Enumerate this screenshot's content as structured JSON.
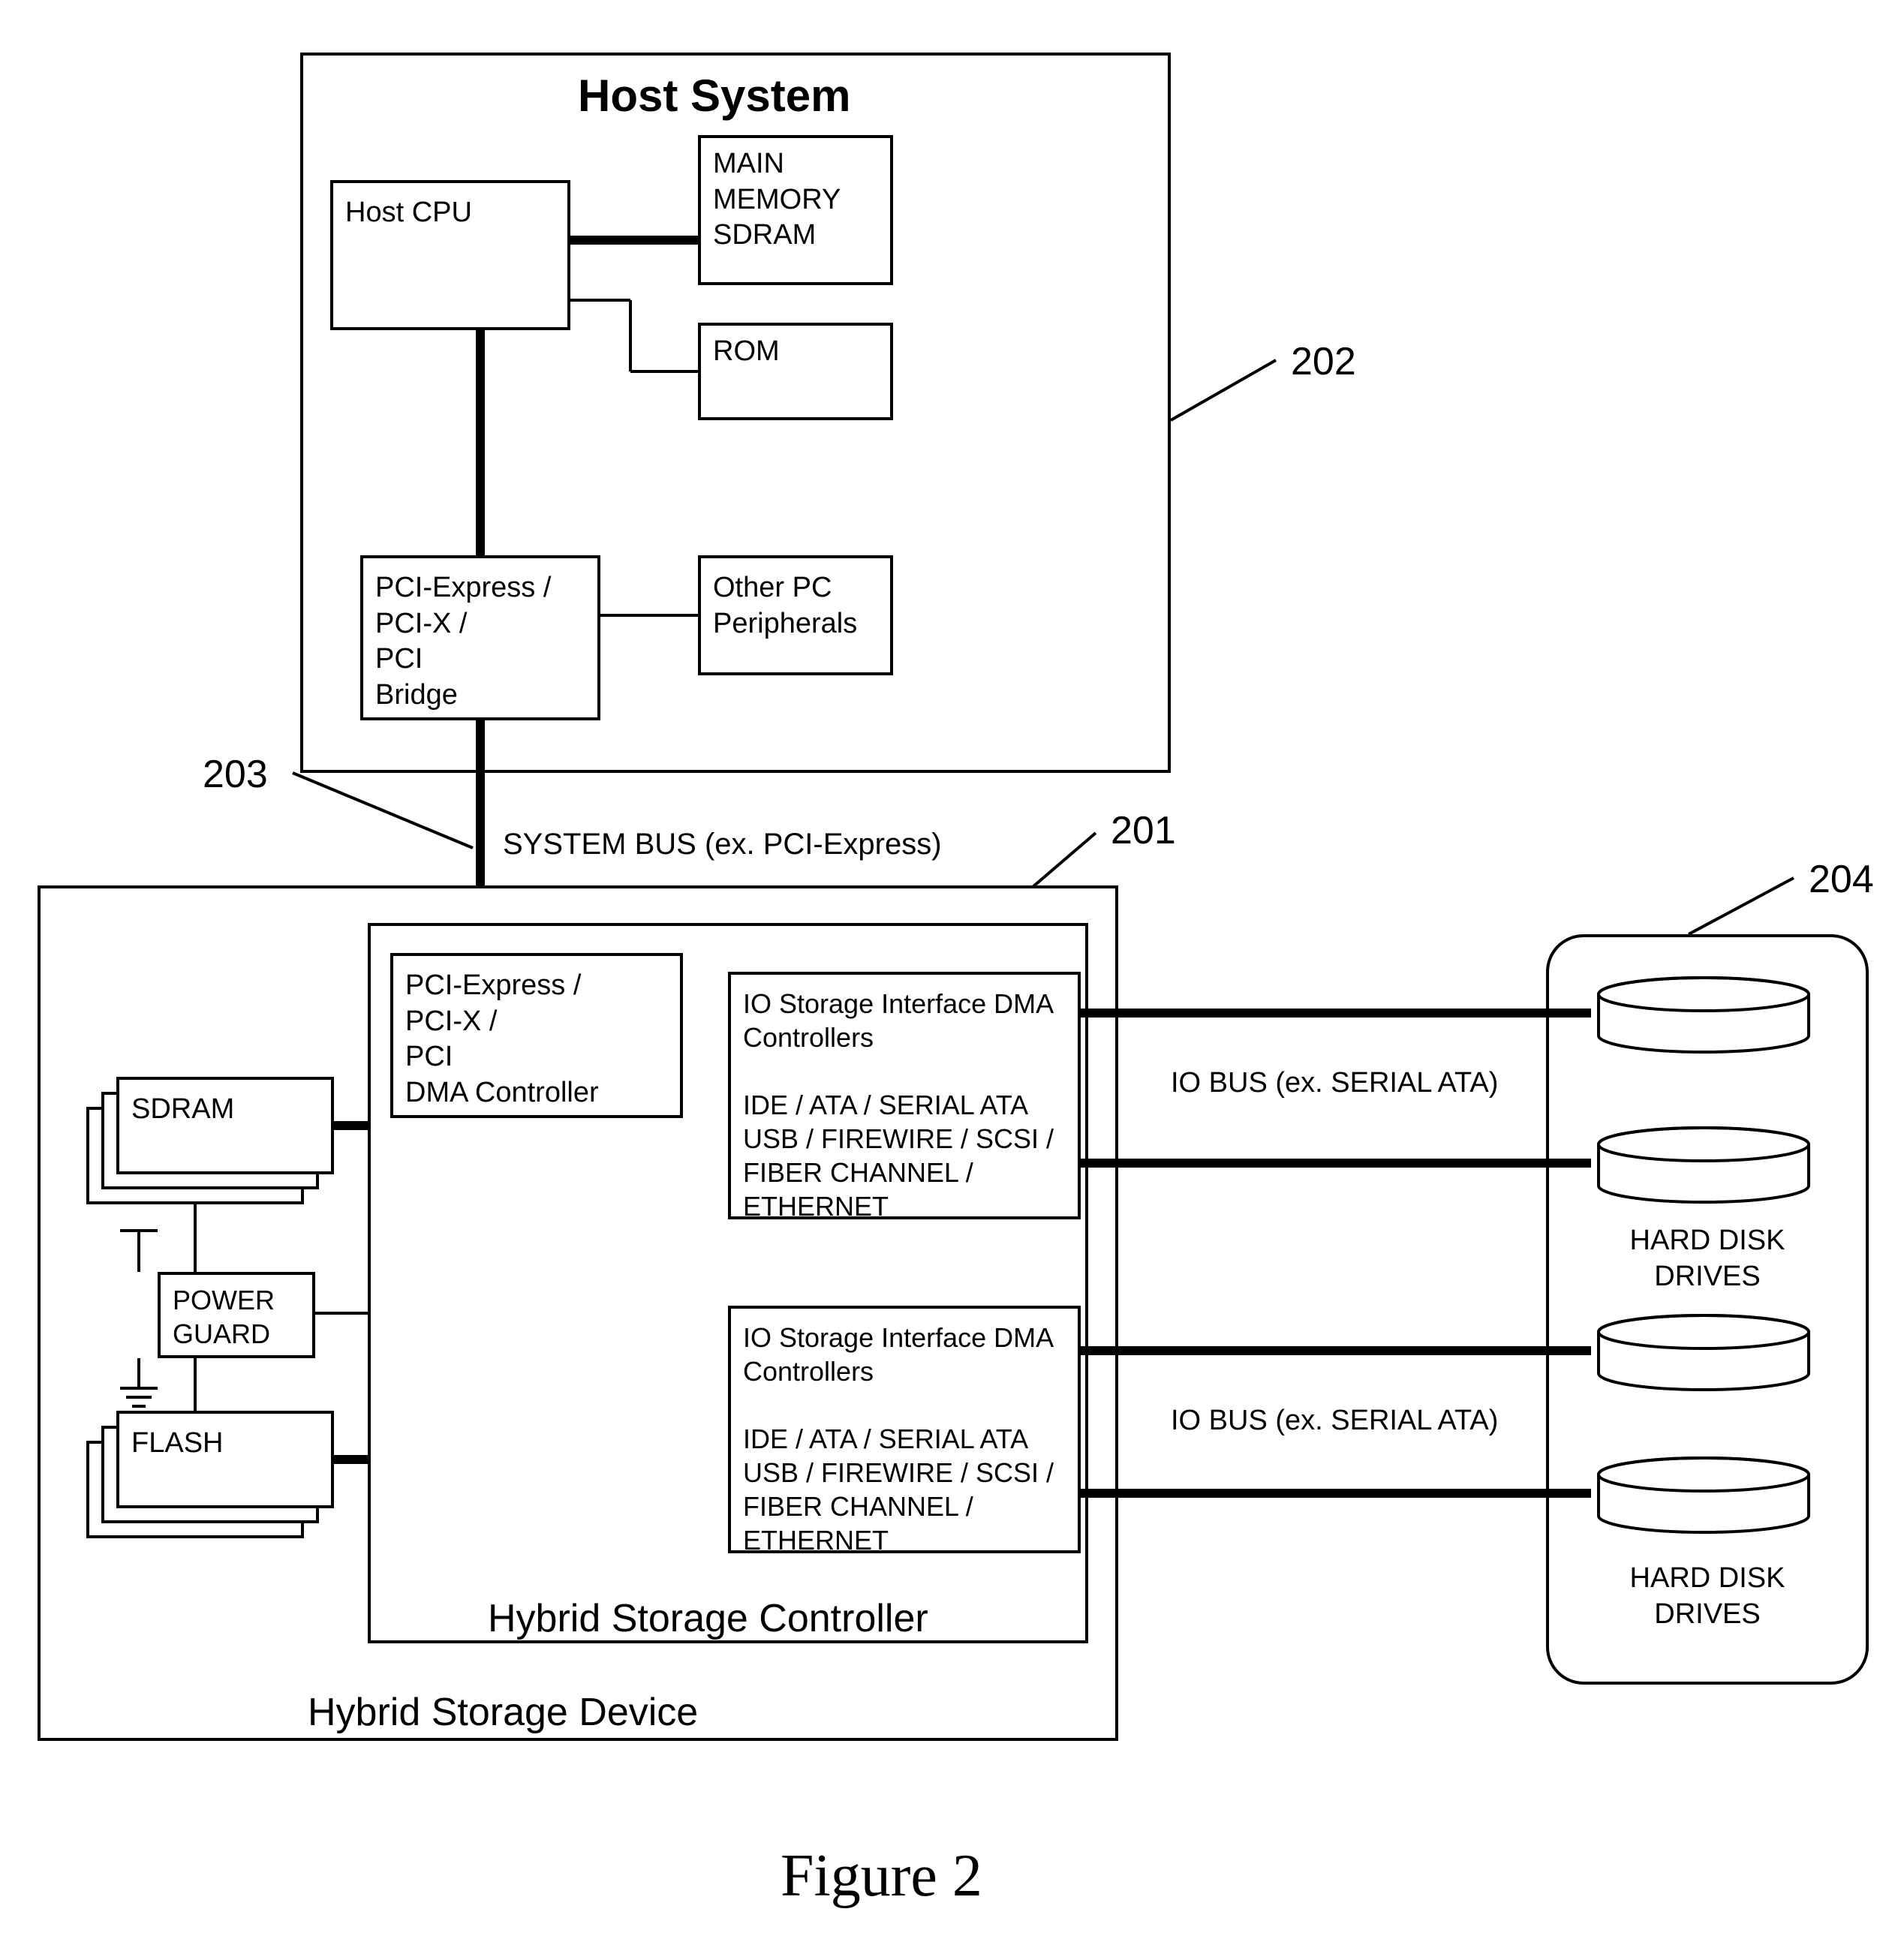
{
  "figure_caption": "Figure 2",
  "callouts": {
    "c201": "201",
    "c202": "202",
    "c203": "203",
    "c204": "204"
  },
  "host_system": {
    "title": "Host System",
    "cpu": "Host CPU",
    "main_memory": "MAIN\nMEMORY\nSDRAM",
    "rom": "ROM",
    "bridge": "PCI-Express /\nPCI-X /\nPCI\nBridge",
    "peripherals": "Other PC\nPeripherals"
  },
  "system_bus_label": "SYSTEM BUS (ex. PCI-Express)",
  "hybrid_storage_device": {
    "title": "Hybrid Storage Device",
    "controller_title": "Hybrid Storage Controller",
    "pci_dma": "PCI-Express /\nPCI-X /\nPCI\nDMA Controller",
    "sdram": "SDRAM",
    "power_guard": "POWER\nGUARD",
    "flash": "FLASH",
    "io_controller": "IO Storage Interface DMA\nControllers\n\nIDE / ATA / SERIAL ATA\nUSB / FIREWIRE / SCSI /\nFIBER CHANNEL /\nETHERNET"
  },
  "io_bus_label": "IO BUS (ex. SERIAL ATA)",
  "hdd_label": "HARD DISK\nDRIVES"
}
